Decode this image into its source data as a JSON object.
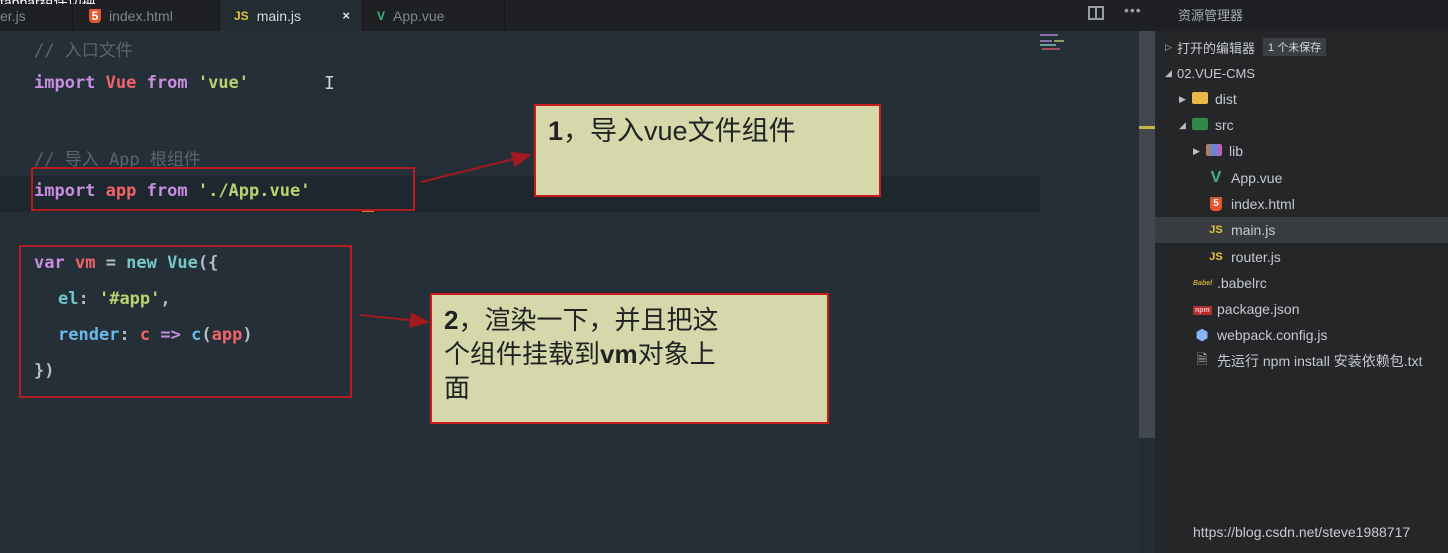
{
  "overlay_title": "tabbar组件切换",
  "tabs": [
    {
      "label": "er.js",
      "icon": "js-icon",
      "active": false
    },
    {
      "label": "index.html",
      "icon": "html5-icon",
      "active": false
    },
    {
      "label": "main.js",
      "icon": "js-icon",
      "active": true,
      "close": "×"
    },
    {
      "label": "App.vue",
      "icon": "vue-icon",
      "active": false
    }
  ],
  "toolbar": {
    "split_editor": "split-editor-icon",
    "more": "•••"
  },
  "code": {
    "line1_comment": "// 入口文件",
    "line2": {
      "kw1": "import",
      "name": "Vue",
      "kw2": "from",
      "str": "'vue'"
    },
    "line4_comment": "// 导入 App 根组件",
    "line5": {
      "kw1": "import",
      "name": "app",
      "kw2": "from",
      "str": "'./App.vue'"
    },
    "line7": {
      "kw": "var",
      "name": "vm",
      "op": " = ",
      "kw2": "new",
      "fn": " Vue",
      "punc": "({"
    },
    "line8": {
      "prop": "el",
      "punc": ": ",
      "str": "'#app'",
      "end": ","
    },
    "line9": {
      "prop": "render",
      "punc": ": ",
      "param": "c",
      "arrow": " => ",
      "call": "c",
      "open": "(",
      "arg": "app",
      "close": ")"
    },
    "line10": "})"
  },
  "annotations": {
    "note1": {
      "num": "1",
      "text": "，导入vue文件组件"
    },
    "note2": {
      "num": "2",
      "line1": "，渲染一下，并且把这",
      "line2a": "个组件挂载到",
      "line2b": "vm",
      "line2c": "对象上",
      "line3": "面"
    }
  },
  "explorer": {
    "title": "资源管理器",
    "open_editors": "打开的编辑器",
    "unsaved_badge": "1 个未保存",
    "root": "02.VUE-CMS",
    "items": [
      {
        "name": "dist",
        "type": "folder",
        "depth": 1,
        "expanded": false
      },
      {
        "name": "src",
        "type": "folder",
        "depth": 1,
        "expanded": true
      },
      {
        "name": "lib",
        "type": "folder",
        "depth": 2,
        "expanded": false
      },
      {
        "name": "App.vue",
        "type": "vue",
        "depth": 2
      },
      {
        "name": "index.html",
        "type": "html",
        "depth": 2
      },
      {
        "name": "main.js",
        "type": "js",
        "depth": 2,
        "selected": true
      },
      {
        "name": "router.js",
        "type": "js",
        "depth": 2
      },
      {
        "name": ".babelrc",
        "type": "babel",
        "depth": 1
      },
      {
        "name": "package.json",
        "type": "npm",
        "depth": 1
      },
      {
        "name": "webpack.config.js",
        "type": "webpack",
        "depth": 1
      },
      {
        "name": "先运行 npm install 安装依赖包.txt",
        "type": "txt",
        "depth": 1
      }
    ]
  },
  "watermark": "https://blog.csdn.net/steve1988717",
  "colors": {
    "annotation_border": "#c81b1b",
    "annotation_bg": "#d4d8ab",
    "editor_bg": "#252f38"
  }
}
